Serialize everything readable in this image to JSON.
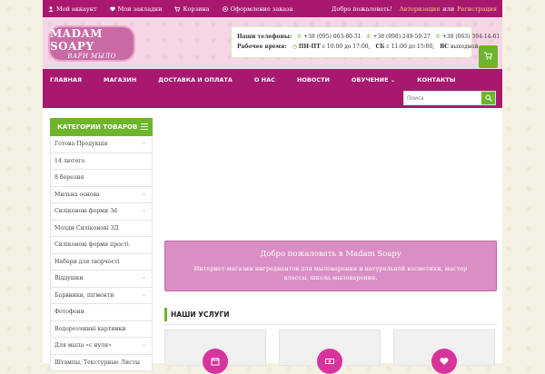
{
  "topbar": {
    "links": [
      {
        "label": "Мой аккаунт",
        "icon": "user-icon"
      },
      {
        "label": "Мои закладки",
        "icon": "heart-icon"
      },
      {
        "label": "Корзина",
        "icon": "cart-icon"
      },
      {
        "label": "Оформление заказа",
        "icon": "share-icon"
      }
    ],
    "welcome": "Добро пожаловать!",
    "login": "Авторизация",
    "or": "или",
    "register": "Регистрация"
  },
  "header": {
    "logo_line1": "MADAM SOAPY",
    "logo_line2": "ВАРИ МЫЛО",
    "phones_label": "Наши телефоны:",
    "phones": [
      "+38 (095) 063-80-31",
      "+38 (098) 249-59-27",
      "+38 (063) 394-14-61"
    ],
    "hours_label": "Рабочее время:",
    "hours": [
      {
        "days": "ПН-ПТ",
        "time": "с 10:00 до 17:00,"
      },
      {
        "days": "СБ",
        "time": "с 11:00 до 15:00,"
      },
      {
        "days": "ВС",
        "time": "выходной"
      }
    ]
  },
  "nav": {
    "items": [
      "ГЛАВНАЯ",
      "МАГАЗИН",
      "ДОСТАВКА И ОПЛАТА",
      "О НАС",
      "НОВОСТИ",
      "ОБУЧЕНИЕ",
      "КОНТАКТЫ"
    ]
  },
  "search": {
    "placeholder": "Поиск"
  },
  "sidebar": {
    "title": "КАТЕГОРИИ ТОВАРОВ",
    "categories": [
      {
        "label": "Готова Продукція",
        "has_children": true
      },
      {
        "label": "14 лютого",
        "has_children": false
      },
      {
        "label": "8 березня",
        "has_children": false
      },
      {
        "label": "Мильна основа",
        "has_children": true
      },
      {
        "label": "Силіконові форми 3d",
        "has_children": true
      },
      {
        "label": "Молди Силіконовi 3Д",
        "has_children": false
      },
      {
        "label": "Силіконові форми прості",
        "has_children": false
      },
      {
        "label": "Набори для творчості",
        "has_children": false
      },
      {
        "label": "Віддушки",
        "has_children": true
      },
      {
        "label": "Барвники, пігменти",
        "has_children": true
      },
      {
        "label": "Фотофони",
        "has_children": false
      },
      {
        "label": "Водорозчинні картинки",
        "has_children": false
      },
      {
        "label": "Для мыла «с нуля»",
        "has_children": true
      },
      {
        "label": "Штампы, Текстурные Листы",
        "has_children": false
      }
    ]
  },
  "welcome_box": {
    "title": "Добро пожаловать в Madam Soapy",
    "text": "Интернет-магазин ингредиентов для мыловарения и натуральной косметики, мастер классы, школа мыловарения."
  },
  "services": {
    "title": "НАШИ УСЛУГИ",
    "icons": [
      "calendar-icon",
      "money-icon",
      "heart-icon"
    ]
  },
  "colors": {
    "primary": "#a8186e",
    "accent": "#6cb52d",
    "welcome": "#d98fc3"
  }
}
